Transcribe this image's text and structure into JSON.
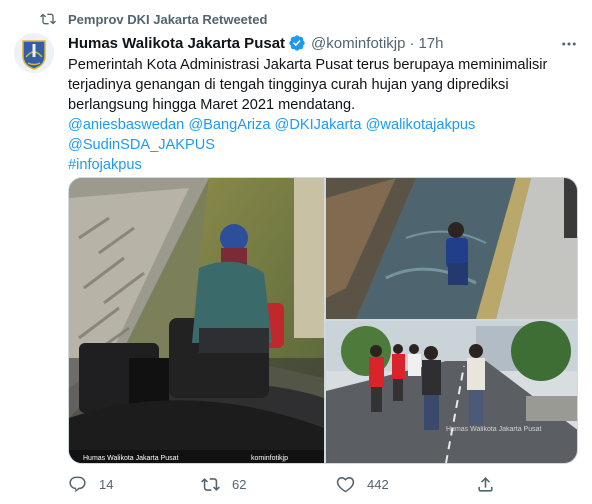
{
  "retweet_context": "Pemprov DKI Jakarta Retweeted",
  "author": {
    "name": "Humas Walikota Jakarta Pusat",
    "handle": "@kominfotikjp",
    "separator": "·",
    "time": "17h"
  },
  "tweet": {
    "lines": [
      "Pemerintah Kota Administrasi Jakarta Pusat terus berupaya meminimalisir",
      "terjadinya genangan di tengah tingginya curah hujan yang diprediksi",
      "berlangsung hingga Maret 2021 mendatang."
    ],
    "mentions_line1": [
      "@aniesbaswedan",
      "@BangAriza",
      "@DKIJakarta",
      "@walikotajakpus"
    ],
    "mentions_line2": [
      "@SudinSDA_JAKPUS"
    ],
    "hashtag": "#infojakpus"
  },
  "media": {
    "watermark_left": "Humas Walikota Jakarta Pusat",
    "watermark_right": "kominfotikjp"
  },
  "actions": {
    "reply_count": "14",
    "retweet_count": "62",
    "like_count": "442"
  },
  "icons": {
    "retweet": "retweet-icon",
    "verified": "verified-badge-icon",
    "more": "more-icon",
    "reply": "reply-icon",
    "like": "heart-icon",
    "share": "share-icon"
  },
  "colors": {
    "accent": "#1d9bf0",
    "muted": "#536471",
    "text": "#0f1419"
  }
}
